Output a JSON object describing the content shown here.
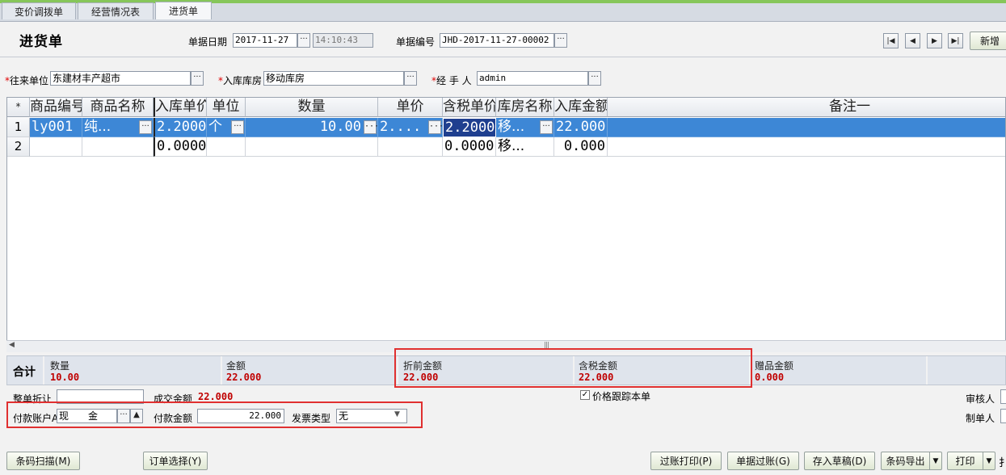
{
  "tabs": [
    {
      "label": "变价调拨单"
    },
    {
      "label": "经营情况表"
    },
    {
      "label": "进货单"
    }
  ],
  "header": {
    "title": "进货单",
    "date_label": "单据日期",
    "date_value": "2017-11-27",
    "time_value": "14:10:43",
    "doc_no_label": "单据编号",
    "doc_no_value": "JHD-2017-11-27-00002",
    "new_button": "新增",
    "dots": "···"
  },
  "form": {
    "partner_label": "往来单位",
    "partner_value": "东建材丰产超市",
    "warehouse_label": "入库库房",
    "warehouse_value": "移动库房",
    "handler_label": "经 手 人",
    "handler_value": "admin",
    "required_mark": "*"
  },
  "grid": {
    "corner": "*",
    "columns": [
      "商品编号",
      "商品名称",
      "入库单价",
      "单位",
      "数量",
      "单价",
      "含税单价",
      "库房名称",
      "入库金额",
      "备注一"
    ],
    "rows": [
      {
        "no": "1",
        "code": "ly001",
        "name": "纯...",
        "in_price": "2.2000",
        "unit": "个",
        "qty": "10.00",
        "price": "2....",
        "tax_price": "2.2000",
        "store": "移...",
        "amount": "22.000",
        "note": ""
      },
      {
        "no": "2",
        "code": "",
        "name": "",
        "in_price": "0.0000",
        "unit": "",
        "qty": "",
        "price": "",
        "tax_price": "0.0000",
        "store": "移...",
        "amount": "0.000",
        "note": ""
      }
    ]
  },
  "summary": {
    "label": "合计",
    "qty_label": "数量",
    "qty_value": "10.00",
    "amount_label": "金额",
    "amount_value": "22.000",
    "pre_discount_label": "折前金额",
    "pre_discount_value": "22.000",
    "tax_amount_label": "含税金额",
    "tax_amount_value": "22.000",
    "gift_label": "赠品金额",
    "gift_value": "0.000"
  },
  "footer": {
    "discount_label": "整单折让",
    "deal_label": "成交金额",
    "deal_value": "22.000",
    "price_track_label": "价格跟踪本单",
    "price_track_checked": true,
    "auditor_label": "审核人",
    "maker_label": "制单人",
    "pay_account_label": "付款账户A",
    "pay_account_value": "现　　金",
    "pay_amount_label": "付款金额",
    "pay_amount_value": "22.000",
    "invoice_label": "发票类型",
    "invoice_value": "无"
  },
  "buttons": {
    "barcode_scan": "条码扫描(M)",
    "order_select": "订单选择(Y)",
    "post_print": "过账打印(P)",
    "post": "单据过账(G)",
    "save_draft": "存入草稿(D)",
    "barcode_export": "条码导出",
    "print": "打印",
    "more": "扌"
  }
}
